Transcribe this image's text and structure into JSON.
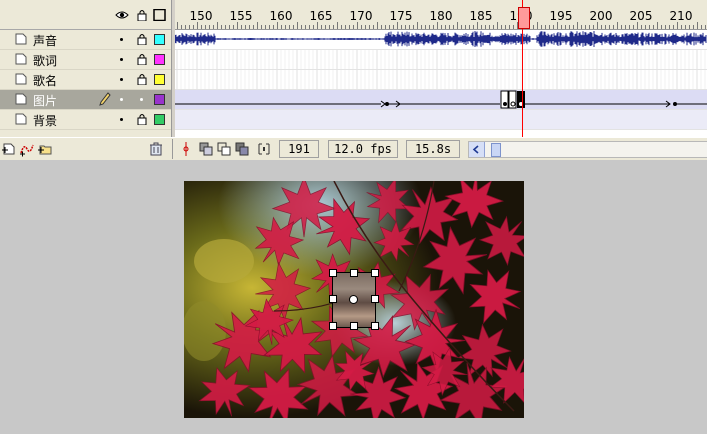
{
  "timeline": {
    "header_icons": [
      "eye-icon",
      "lock-icon",
      "outline-icon"
    ],
    "ruler_labels": [
      "150",
      "155",
      "160",
      "165",
      "170",
      "175",
      "180",
      "185",
      "190",
      "195",
      "200",
      "205",
      "210"
    ],
    "layers": [
      {
        "name": "声音",
        "color": "#33ffff",
        "selected": false
      },
      {
        "name": "歌词",
        "color": "#ff33ff",
        "selected": false
      },
      {
        "name": "歌名",
        "color": "#ffff33",
        "selected": false
      },
      {
        "name": "图片",
        "color": "#9933cc",
        "selected": true
      },
      {
        "name": "背景",
        "color": "#33cc66",
        "selected": false
      }
    ],
    "current_frame": "191",
    "frame_rate": "12.0 fps",
    "elapsed_time": "15.8s",
    "toolbar_icons": [
      "insert-layer-icon",
      "add-motion-guide-icon",
      "insert-layer-folder-icon",
      "delete-layer-icon",
      "center-frame-icon",
      "onion-skin-icon",
      "onion-skin-outlines-icon",
      "edit-multiple-frames-icon",
      "modify-onion-markers-icon"
    ]
  },
  "colors": {
    "panel_bg": "#ece9d8",
    "stage_bg": "#c8c8c8",
    "playhead": "#ff0000",
    "waveform": "#1f2a8a"
  }
}
